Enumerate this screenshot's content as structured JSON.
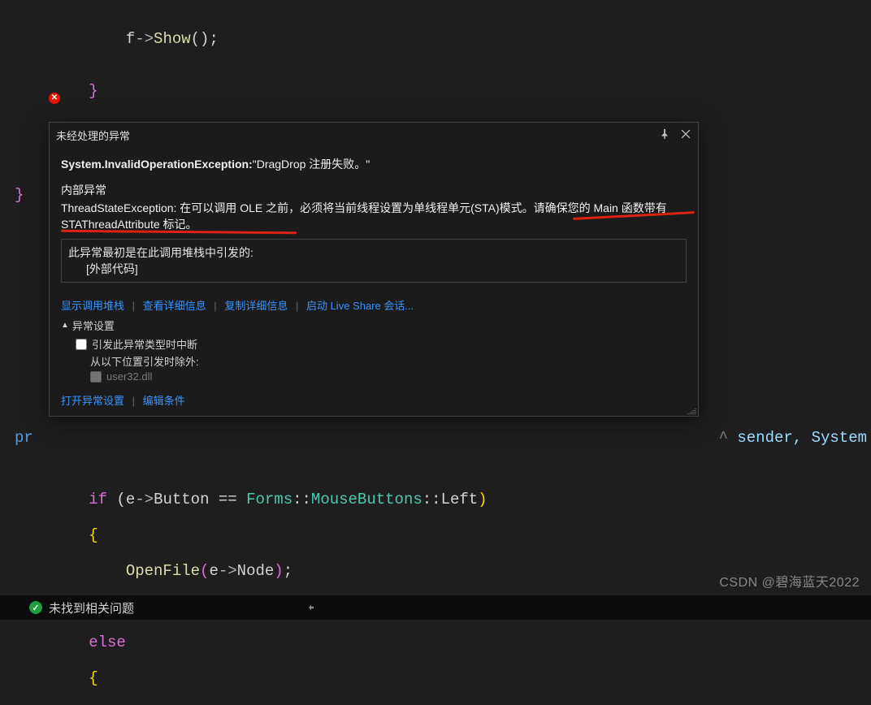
{
  "code": {
    "line1": {
      "var": "f",
      "arrow": "->",
      "method": "Show",
      "args": "()",
      "semi": ";"
    },
    "brace_close_inner": "}",
    "brace_close_outer": "}",
    "method_vis_left": "pr",
    "method_vis_right_caret": "^",
    "method_vis_right": " sender, System",
    "if_kw": "if",
    "open_p": " (",
    "e_var": "e",
    "arrow": "->",
    "button_prop": "Button",
    "eq": " == ",
    "forms": "Forms",
    "scope1": "::",
    "mousebuttons": "MouseButtons",
    "scope2": "::",
    "left": "Left",
    "close_p": ")",
    "open_brace": "{",
    "call_fn": "OpenFile",
    "call_arg_open": "(",
    "e2": "e",
    "arrow2": "->",
    "node": "Node",
    "call_close": ")",
    "semi2": ";",
    "close_brace": "}",
    "else_kw": "else",
    "open_brace2": "{"
  },
  "exception": {
    "title": "未经处理的异常",
    "main_prefix": "System.InvalidOperationException:",
    "main_msg": "\"DragDrop 注册失败。\"",
    "inner_label": "内部异常",
    "inner_text": "ThreadStateException: 在可以调用 OLE 之前，必须将当前线程设置为单线程单元(STA)模式。请确保您的 Main 函数带有 STAThreadAttribute 标记。",
    "stack_label": "此异常最初是在此调用堆栈中引发的:",
    "stack_item": "[外部代码]",
    "links": {
      "show_stack": "显示调用堆栈",
      "details": "查看详细信息",
      "copy": "复制详细信息",
      "liveshare": "启动 Live Share 会话..."
    },
    "settings": {
      "header": "异常设置",
      "break_on_type": "引发此异常类型时中断",
      "except_from": "从以下位置引发时除外:",
      "module": "user32.dll"
    },
    "footer": {
      "open_settings": "打开异常设置",
      "edit_cond": "编辑条件"
    }
  },
  "status": {
    "message": "未找到相关问题"
  },
  "watermark": "CSDN @碧海蓝天2022"
}
